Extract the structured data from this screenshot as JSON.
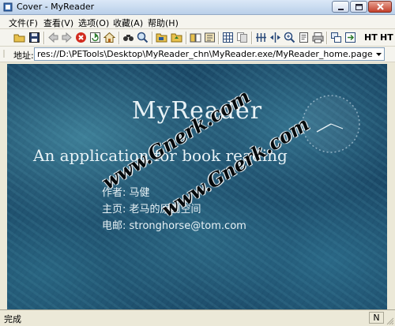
{
  "window": {
    "title": "Cover - MyReader"
  },
  "menu": [
    {
      "label": "文件(F)"
    },
    {
      "label": "查看(V)"
    },
    {
      "label": "选项(O)"
    },
    {
      "label": "收藏(A)"
    },
    {
      "label": "帮助(H)"
    }
  ],
  "toolbar": {
    "icons": [
      "open-folder-icon",
      "save-icon",
      "back-arrow-icon",
      "forward-arrow-icon",
      "stop-icon",
      "refresh-icon",
      "home-icon",
      "find-icon",
      "search-icon",
      "folder-icon",
      "folder-up-icon",
      "book-icon",
      "bookmarks-icon",
      "grid-view-icon",
      "copy-icon",
      "columns-icon",
      "split-icon",
      "zoom-icon",
      "page-icon",
      "print-icon",
      "windows-icon",
      "export-icon"
    ],
    "ht_label": "HT",
    "ht2_label": "HT"
  },
  "address": {
    "label": "地址:",
    "value": "res://D:\\PETools\\Desktop\\MyReader_chn\\MyReader.exe/MyReader_home.page"
  },
  "content": {
    "heading": "MyReader",
    "subtitle": "An application for book reading",
    "author": "作者: 马健",
    "homepage": "主页: 老马的原创空间",
    "email": "电邮: stronghorse@tom.com",
    "watermark": "www.Gnerk.com",
    "watermark2": "www.Gnerk.com"
  },
  "status": {
    "text": "完成",
    "mode": "N"
  },
  "colors": {
    "content_bg": "#1c4a68",
    "text": "#e8f2f6",
    "titlebar": "#b9cfe9"
  }
}
